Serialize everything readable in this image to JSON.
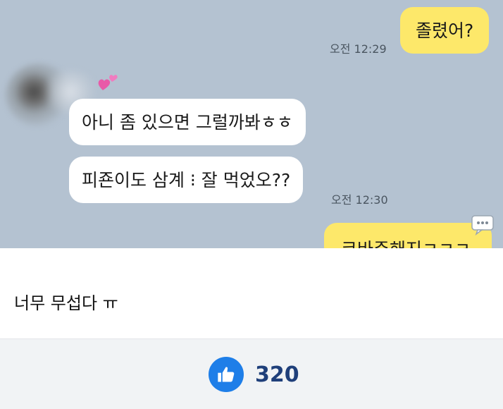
{
  "chat": {
    "messages": [
      {
        "side": "mine",
        "text": "졸렸어?"
      },
      {
        "side": "theirs",
        "text": "아니 좀 있으면 그럴까봐ㅎㅎ"
      },
      {
        "side": "theirs",
        "text": "피죤이도 삼계 ⁝ 잘 먹었오??"
      },
      {
        "side": "mine",
        "text": "코바주해지ㅋㅋㅋ"
      }
    ],
    "times": {
      "first": "오전 12:29",
      "second": "오전 12:30"
    }
  },
  "comment": {
    "text": "너무 무섭다 ㅠ"
  },
  "like": {
    "count": "320",
    "icon": "thumbs-up-icon",
    "color": "#1e7ee8"
  },
  "colors": {
    "chat_background": "#b4c2d1",
    "my_bubble": "#fde86a",
    "their_bubble": "#ffffff",
    "count_text": "#1f3f7a"
  }
}
